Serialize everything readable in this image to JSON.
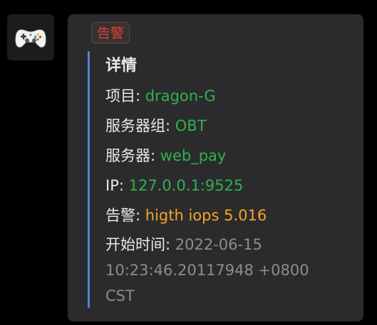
{
  "avatar": {
    "icon": "gamepad-icon"
  },
  "alert": {
    "tag_label": "告警",
    "title": "详情",
    "fields": [
      {
        "label": "项目: ",
        "value": "dragon-G"
      },
      {
        "label": "服务器组: ",
        "value": "OBT"
      },
      {
        "label": "服务器: ",
        "value": "web_pay"
      },
      {
        "label": "IP: ",
        "value": "127.0.0.1:9525"
      },
      {
        "label": "告警: ",
        "value": "higth iops 5.016"
      },
      {
        "label": "开始时间: ",
        "value": "2022-06-15 10:23:46.20117948 +0800 CST"
      }
    ]
  },
  "colors": {
    "tag_text": "#d9443e",
    "quote_bar": "#4f86d6",
    "value_green": "#2fb24c",
    "value_orange": "#f5a623",
    "value_gray": "#8d8d8d"
  }
}
